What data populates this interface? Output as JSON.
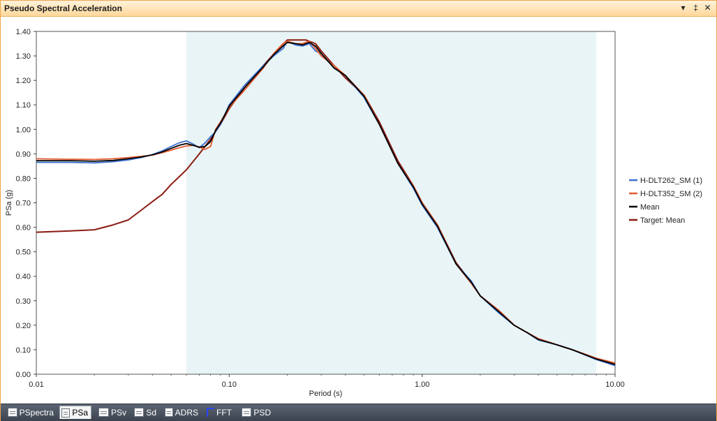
{
  "window": {
    "title": "Pseudo Spectral Acceleration",
    "buttons": {
      "dropdown": "▾",
      "pin": "‡",
      "close": "✕"
    }
  },
  "tabs": [
    {
      "label": "PSpectra",
      "icon": "spectra-icon",
      "active": false
    },
    {
      "label": "PSa",
      "icon": "psa-icon",
      "active": true
    },
    {
      "label": "PSv",
      "icon": "psv-icon",
      "active": false
    },
    {
      "label": "Sd",
      "icon": "sd-icon",
      "active": false
    },
    {
      "label": "ADRS",
      "icon": "adrs-icon",
      "active": false
    },
    {
      "label": "FFT",
      "icon": "fft-icon",
      "active": false
    },
    {
      "label": "PSD",
      "icon": "psd-icon",
      "active": false
    }
  ],
  "chart_data": {
    "type": "line",
    "title": "",
    "xlabel": "Period (s)",
    "ylabel": "PSa (g)",
    "xscale": "log",
    "xlim": [
      0.01,
      10
    ],
    "ylim": [
      0,
      1.4
    ],
    "xticks": [
      "0.01",
      "0.10",
      "1.00",
      "10.00"
    ],
    "yticks": [
      "0.00",
      "0.10",
      "0.20",
      "0.30",
      "0.40",
      "0.50",
      "0.60",
      "0.70",
      "0.80",
      "0.90",
      "1.00",
      "1.10",
      "1.20",
      "1.30",
      "1.40"
    ],
    "shaded_range": [
      0.06,
      8.0
    ],
    "shade_color": "#e9f4f6",
    "legend_position": "right",
    "series": [
      {
        "name": "H-DLT262_SM (1)",
        "color": "#3a6fcf",
        "x": [
          0.01,
          0.015,
          0.02,
          0.025,
          0.03,
          0.035,
          0.04,
          0.045,
          0.05,
          0.055,
          0.06,
          0.065,
          0.07,
          0.075,
          0.08,
          0.085,
          0.09,
          0.1,
          0.12,
          0.15,
          0.17,
          0.19,
          0.2,
          0.22,
          0.24,
          0.26,
          0.28,
          0.3,
          0.35,
          0.4,
          0.5,
          0.6,
          0.75,
          0.9,
          1.0,
          1.2,
          1.5,
          1.8,
          2.0,
          2.5,
          3.0,
          3.5,
          4.0,
          5.0,
          6.0,
          8.0,
          10.0
        ],
        "y": [
          0.865,
          0.865,
          0.863,
          0.868,
          0.875,
          0.885,
          0.897,
          0.912,
          0.93,
          0.945,
          0.953,
          0.94,
          0.925,
          0.945,
          0.97,
          0.99,
          1.02,
          1.1,
          1.18,
          1.26,
          1.3,
          1.33,
          1.36,
          1.345,
          1.34,
          1.35,
          1.32,
          1.31,
          1.25,
          1.22,
          1.13,
          1.02,
          0.86,
          0.76,
          0.69,
          0.6,
          0.45,
          0.38,
          0.32,
          0.25,
          0.2,
          0.17,
          0.14,
          0.12,
          0.1,
          0.06,
          0.035
        ]
      },
      {
        "name": "H-DLT352_SM (2)",
        "color": "#e35a2e",
        "x": [
          0.01,
          0.015,
          0.02,
          0.025,
          0.03,
          0.035,
          0.04,
          0.045,
          0.05,
          0.055,
          0.06,
          0.065,
          0.07,
          0.075,
          0.08,
          0.085,
          0.09,
          0.1,
          0.12,
          0.15,
          0.17,
          0.19,
          0.2,
          0.22,
          0.24,
          0.26,
          0.28,
          0.3,
          0.35,
          0.4,
          0.5,
          0.6,
          0.75,
          0.9,
          1.0,
          1.2,
          1.5,
          1.8,
          2.0,
          2.5,
          3.0,
          3.5,
          4.0,
          5.0,
          6.0,
          8.0,
          10.0
        ],
        "y": [
          0.88,
          0.878,
          0.877,
          0.88,
          0.885,
          0.89,
          0.895,
          0.905,
          0.915,
          0.925,
          0.932,
          0.935,
          0.928,
          0.918,
          0.93,
          1.0,
          1.03,
          1.09,
          1.16,
          1.25,
          1.31,
          1.35,
          1.36,
          1.35,
          1.35,
          1.36,
          1.33,
          1.3,
          1.26,
          1.22,
          1.14,
          1.02,
          0.86,
          0.77,
          0.7,
          0.61,
          0.45,
          0.37,
          0.32,
          0.26,
          0.2,
          0.17,
          0.145,
          0.12,
          0.1,
          0.065,
          0.045
        ]
      },
      {
        "name": "Mean",
        "color": "#000000",
        "x": [
          0.01,
          0.015,
          0.02,
          0.025,
          0.03,
          0.035,
          0.04,
          0.045,
          0.05,
          0.055,
          0.06,
          0.065,
          0.07,
          0.075,
          0.08,
          0.085,
          0.09,
          0.1,
          0.12,
          0.15,
          0.17,
          0.19,
          0.2,
          0.22,
          0.24,
          0.26,
          0.28,
          0.3,
          0.35,
          0.4,
          0.5,
          0.6,
          0.75,
          0.9,
          1.0,
          1.2,
          1.5,
          1.8,
          2.0,
          2.5,
          3.0,
          3.5,
          4.0,
          5.0,
          6.0,
          8.0,
          10.0
        ],
        "y": [
          0.872,
          0.872,
          0.87,
          0.873,
          0.88,
          0.887,
          0.896,
          0.908,
          0.922,
          0.935,
          0.942,
          0.935,
          0.927,
          0.93,
          0.95,
          0.995,
          1.025,
          1.095,
          1.17,
          1.255,
          1.305,
          1.34,
          1.355,
          1.35,
          1.345,
          1.355,
          1.34,
          1.31,
          1.25,
          1.22,
          1.135,
          1.02,
          0.86,
          0.765,
          0.695,
          0.605,
          0.45,
          0.375,
          0.32,
          0.255,
          0.2,
          0.17,
          0.142,
          0.12,
          0.1,
          0.062,
          0.04
        ]
      },
      {
        "name": "Target: Mean",
        "color": "#8b1a10",
        "x": [
          0.01,
          0.015,
          0.02,
          0.025,
          0.03,
          0.035,
          0.04,
          0.045,
          0.05,
          0.06,
          0.07,
          0.08,
          0.09,
          0.1,
          0.12,
          0.15,
          0.18,
          0.2,
          0.22,
          0.25,
          0.28,
          0.3,
          0.35,
          0.4,
          0.5,
          0.6,
          0.75,
          0.9,
          1.0,
          1.2,
          1.5,
          1.8,
          2.0,
          2.5,
          3.0,
          3.5,
          4.0,
          5.0,
          6.0,
          8.0,
          10.0
        ],
        "y": [
          0.58,
          0.585,
          0.59,
          0.61,
          0.63,
          0.67,
          0.705,
          0.735,
          0.775,
          0.835,
          0.9,
          0.96,
          1.02,
          1.085,
          1.17,
          1.26,
          1.33,
          1.365,
          1.365,
          1.365,
          1.35,
          1.32,
          1.26,
          1.21,
          1.14,
          1.03,
          0.87,
          0.77,
          0.7,
          0.61,
          0.455,
          0.375,
          0.32,
          0.26,
          0.2,
          0.17,
          0.145,
          0.12,
          0.1,
          0.065,
          0.045
        ]
      }
    ]
  }
}
